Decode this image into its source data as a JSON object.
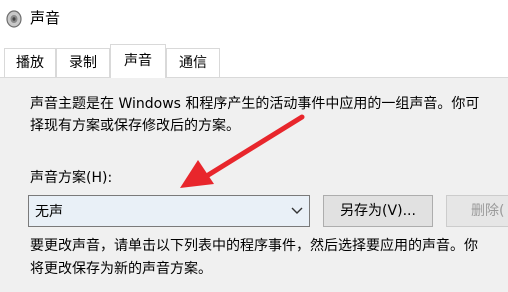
{
  "window": {
    "title": "声音",
    "icon": "speaker-icon"
  },
  "tabs": [
    {
      "label": "播放",
      "active": false
    },
    {
      "label": "录制",
      "active": false
    },
    {
      "label": "声音",
      "active": true
    },
    {
      "label": "通信",
      "active": false
    }
  ],
  "panel": {
    "description_line1": "声音主题是在 Windows 和程序产生的活动事件中应用的一组声音。你可",
    "description_line2": "择现有方案或保存修改后的方案。",
    "scheme_label": "声音方案(H):",
    "scheme_select": {
      "value": "无声"
    },
    "save_as_button": "另存为(V)...",
    "delete_button": "删除(",
    "instruction_line1": "要更改声音，请单击以下列表中的程序事件，然后选择要应用的声音。你",
    "instruction_line2": "将更改保存为新的声音方案。"
  },
  "annotation": {
    "color": "#e8262c"
  }
}
